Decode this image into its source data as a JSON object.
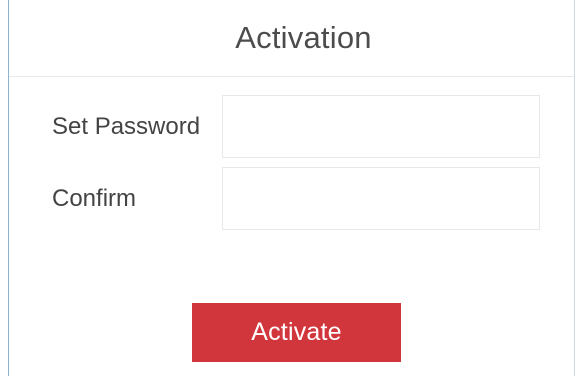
{
  "dialog": {
    "title": "Activation"
  },
  "form": {
    "password_label": "Set Password",
    "password_value": "",
    "confirm_label": "Confirm",
    "confirm_value": ""
  },
  "actions": {
    "activate_label": "Activate"
  },
  "colors": {
    "accent": "#d2363d",
    "title_text": "#4c4c4c",
    "label_text": "#444444",
    "input_border": "#e8e8e8",
    "dialog_border": "#8fb3d2"
  }
}
